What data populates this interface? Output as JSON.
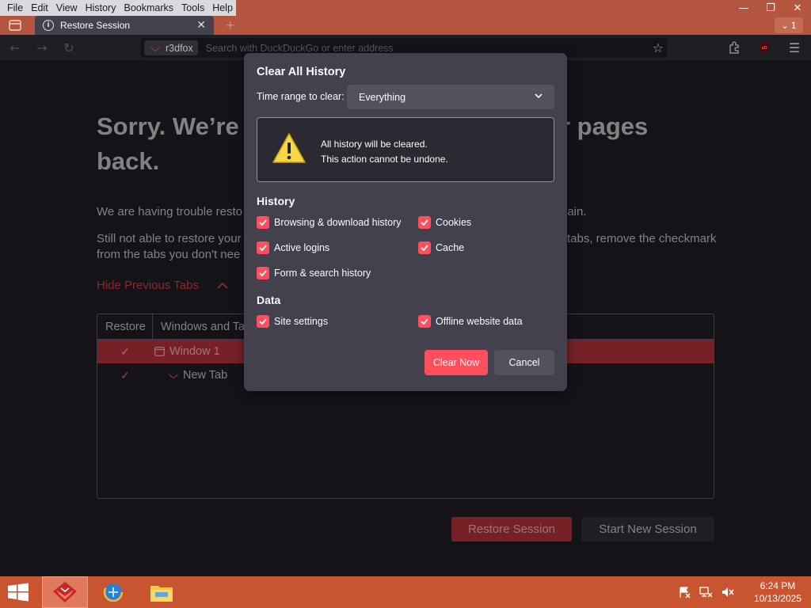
{
  "menu": [
    "File",
    "Edit",
    "View",
    "History",
    "Bookmarks",
    "Tools",
    "Help"
  ],
  "tab": {
    "title": "Restore Session",
    "count": "1"
  },
  "urlbar": {
    "identity": "r3dfox",
    "placeholder": "Search with DuckDuckGo or enter address"
  },
  "page": {
    "title_line1_left": "Sorry. We’re",
    "title_line1_right": "r pages",
    "title_line2": "back.",
    "para1_left": "We are having trouble resto",
    "para1_right": "gain.",
    "para2_left_line1": "Still not able to restore your",
    "para2_right_line1": "tabs, remove the checkmark",
    "para2_left_line2": "from the tabs you don't nee",
    "hide_tabs": "Hide Previous Tabs",
    "col_restore": "Restore",
    "col_windows": "Windows and Ta",
    "rows": [
      {
        "label": "Window 1"
      },
      {
        "label": "New Tab"
      }
    ],
    "restore_button": "Restore Session",
    "new_session_button": "Start New Session"
  },
  "dialog": {
    "title": "Clear All History",
    "range_label": "Time range to clear:",
    "range_value": "Everything",
    "warn_line1": "All history will be cleared.",
    "warn_line2": "This action cannot be undone.",
    "history_head": "History",
    "history_items": [
      "Browsing & download history",
      "Cookies",
      "Active logins",
      "Cache",
      "Form & search history"
    ],
    "data_head": "Data",
    "data_items": [
      "Site settings",
      "Offline website data"
    ],
    "clear_button": "Clear Now",
    "cancel_button": "Cancel"
  },
  "taskbar": {
    "time": "6:24 PM",
    "date": "10/13/2025"
  },
  "colors": {
    "accent": "#ff4f5e",
    "titlebar": "#b4553f",
    "taskbar": "#c8552f",
    "dialog_bg": "#42414d"
  }
}
